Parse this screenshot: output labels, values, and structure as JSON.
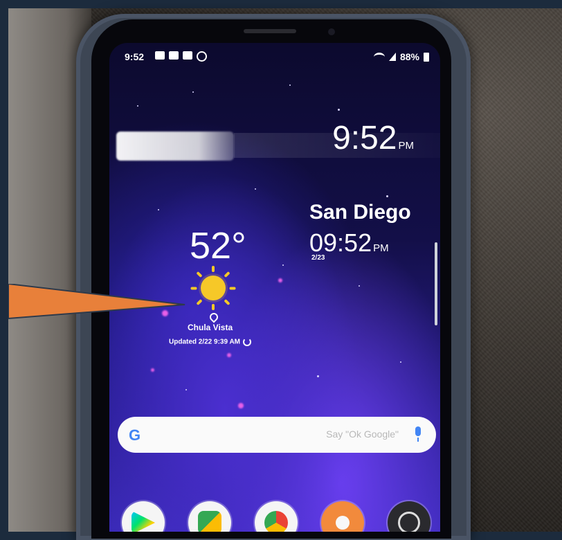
{
  "status_bar": {
    "time": "9:52",
    "battery": "88%",
    "notification_icons": [
      "linkedin-icon",
      "notification-icon",
      "message-icon",
      "instagram-icon"
    ]
  },
  "clock": {
    "time": "9:52",
    "ampm": "PM"
  },
  "world_clock": {
    "city": "San Diego",
    "time": "09:52",
    "ampm": "PM",
    "date": "2/23"
  },
  "weather": {
    "temperature": "52°",
    "icon": "sun-icon",
    "location": "Chula Vista",
    "updated": "Updated 2/22 9:39 AM"
  },
  "search": {
    "logo": "G",
    "hint": "Say \"Ok Google\""
  },
  "dock": {
    "apps": [
      "play-store-icon",
      "google-maps-icon",
      "chrome-icon",
      "yelp-icon",
      "clock-app-icon"
    ]
  },
  "colors": {
    "pointer_arrow": "#e8803a",
    "sun": "#f6c828",
    "google_blue": "#4285f4"
  }
}
